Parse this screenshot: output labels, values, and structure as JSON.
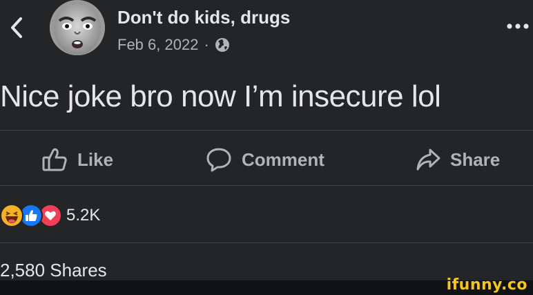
{
  "post": {
    "author": "Don't do kids, drugs",
    "date": "Feb 6, 2022",
    "separator": "·",
    "audience_icon": "globe-icon",
    "text": "Nice joke bro now I’m insecure lol"
  },
  "actions": {
    "like_label": "Like",
    "comment_label": "Comment",
    "share_label": "Share"
  },
  "reactions": {
    "icons": [
      "haha-icon",
      "like-icon",
      "love-icon"
    ],
    "count": "5.2K"
  },
  "shares": {
    "text": "2,580 Shares"
  },
  "watermark": {
    "text": "ifunny.co"
  },
  "colors": {
    "background": "#242526",
    "primary_text": "#e4e6eb",
    "secondary_text": "#b0b3b8",
    "like_blue": "#1877f2",
    "love_red": "#f33e58",
    "haha_yellow": "#f7b125",
    "watermark_yellow": "#f5c518"
  }
}
